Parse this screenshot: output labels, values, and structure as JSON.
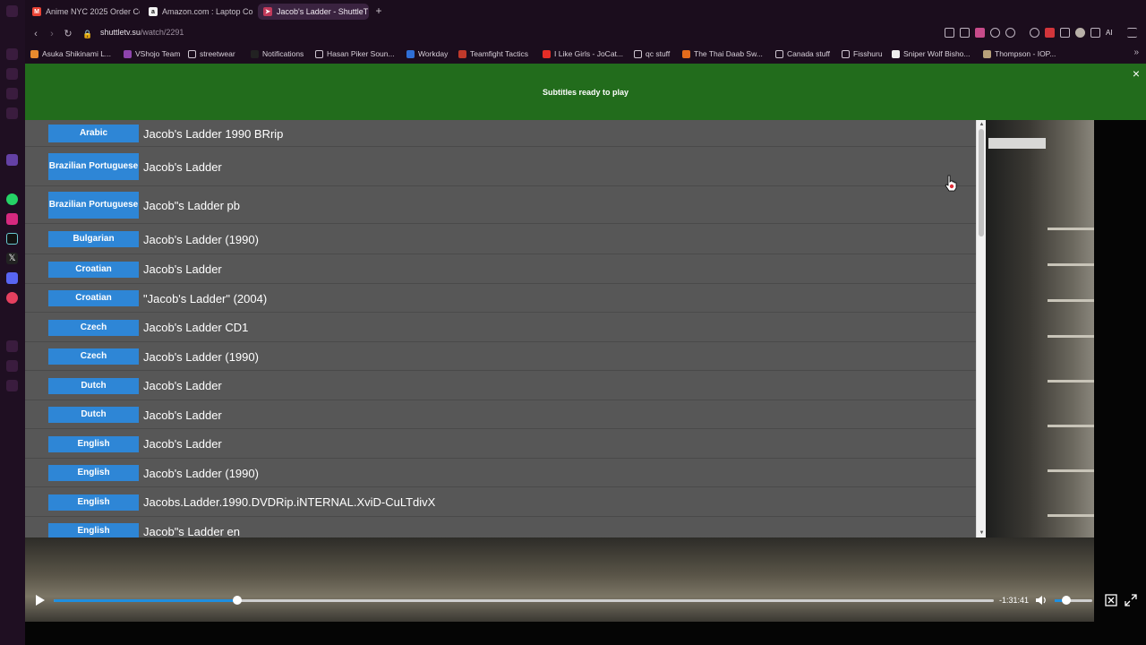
{
  "browser": {
    "tabs": [
      {
        "label": "Anime NYC 2025 Order Co",
        "favicon": "gmail-icon",
        "active": false
      },
      {
        "label": "Amazon.com : Laptop Co",
        "favicon": "amazon-icon",
        "active": false
      },
      {
        "label": "Jacob's Ladder - ShuttleT",
        "favicon": "shuttle-icon",
        "active": true
      }
    ],
    "new_tab": "+",
    "url_host": "shuttletv.su",
    "url_path": "/watch/2291",
    "bookmarks": [
      {
        "label": "Asuka Shikinami L...",
        "icon": "orange-icon"
      },
      {
        "label": "VShojo Team",
        "icon": "purple-icon"
      },
      {
        "label": "streetwear",
        "icon": "folder-icon"
      },
      {
        "label": "Notifications",
        "icon": "x-icon"
      },
      {
        "label": "Hasan Piker Soun...",
        "icon": "page-icon"
      },
      {
        "label": "Workday",
        "icon": "workday-icon"
      },
      {
        "label": "Teamfight Tactics",
        "icon": "tft-icon"
      },
      {
        "label": "I Like Girls - JoCat...",
        "icon": "youtube-icon"
      },
      {
        "label": "qc stuff",
        "icon": "folder-icon"
      },
      {
        "label": "The Thai Daab Sw...",
        "icon": "etsy-icon"
      },
      {
        "label": "Canada stuff",
        "icon": "folder-icon"
      },
      {
        "label": "Fisshuru",
        "icon": "folder-icon"
      },
      {
        "label": "Sniper Wolf Bisho...",
        "icon": "s-icon"
      },
      {
        "label": "Thompson - IOP...",
        "icon": "thompson-icon"
      }
    ],
    "ai_label": "AI"
  },
  "banner": {
    "message": "Subtitles ready to play",
    "close": "×"
  },
  "subtitles": [
    {
      "language": "Arabic",
      "title": "Jacob's Ladder 1990 BRrip"
    },
    {
      "language": "Brazilian Portuguese",
      "title": "Jacob's Ladder"
    },
    {
      "language": "Brazilian Portuguese",
      "title": "Jacob\"s Ladder pb"
    },
    {
      "language": "Bulgarian",
      "title": "Jacob's Ladder (1990)"
    },
    {
      "language": "Croatian",
      "title": "Jacob's Ladder"
    },
    {
      "language": "Croatian",
      "title": "\"Jacob's Ladder\" (2004)"
    },
    {
      "language": "Czech",
      "title": "Jacob's Ladder CD1"
    },
    {
      "language": "Czech",
      "title": "Jacob's Ladder (1990)"
    },
    {
      "language": "Dutch",
      "title": "Jacob's Ladder"
    },
    {
      "language": "Dutch",
      "title": "Jacob's Ladder"
    },
    {
      "language": "English",
      "title": "Jacob's Ladder"
    },
    {
      "language": "English",
      "title": "Jacob's Ladder (1990)"
    },
    {
      "language": "English",
      "title": "Jacobs.Ladder.1990.DVDRip.iNTERNAL.XviD-CuLTdivX"
    },
    {
      "language": "English",
      "title": "Jacob\"s Ladder en"
    }
  ],
  "player": {
    "time_remaining": "-1:31:41",
    "progress": 0.195,
    "volume": 0.3
  },
  "colors": {
    "banner": "#226c1c",
    "language_badge": "#2e86d6",
    "list_bg": "#575757",
    "progress": "#1e8fe0"
  }
}
